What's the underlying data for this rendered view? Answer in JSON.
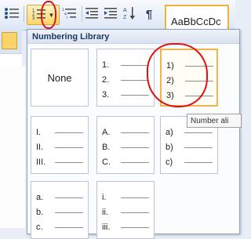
{
  "ribbon": {
    "bullets_icon": "bullet-list-icon",
    "numbering_icon": "numbered-list-icon",
    "multilevel_icon": "multilevel-list-icon",
    "style_preview": "AaBbCcDc"
  },
  "panel": {
    "title": "Numbering Library",
    "none_label": "None",
    "tiles": [
      {
        "rows": [
          "1.",
          "2.",
          "3."
        ]
      },
      {
        "rows": [
          "1)",
          "2)",
          "3)"
        ]
      },
      {
        "rows": [
          "I.",
          "II.",
          "III."
        ]
      },
      {
        "rows": [
          "A.",
          "B.",
          "C."
        ]
      },
      {
        "rows": [
          "a)",
          "b)",
          "c)"
        ]
      },
      {
        "rows": [
          "a.",
          "b.",
          "c."
        ]
      },
      {
        "rows": [
          "i.",
          "ii.",
          "iii."
        ]
      }
    ]
  },
  "tooltip": {
    "text": "Number ali"
  },
  "colors": {
    "annotation": "#e01010",
    "highlight": "#f1b44c"
  }
}
